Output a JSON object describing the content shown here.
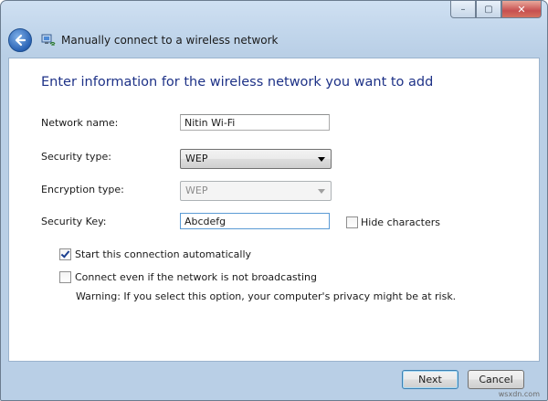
{
  "window": {
    "title": "Manually connect to a wireless network",
    "caption_buttons": {
      "minimize": "–",
      "maximize": "▢",
      "close": "✕"
    }
  },
  "icons": {
    "back": "back-arrow-icon",
    "network": "wireless-network-icon"
  },
  "form": {
    "heading": "Enter information for the wireless network you want to add",
    "network_name": {
      "label": "Network name:",
      "value": "Nitin Wi-Fi"
    },
    "security_type": {
      "label": "Security type:",
      "value": "WEP"
    },
    "encryption_type": {
      "label": "Encryption type:",
      "value": "WEP"
    },
    "security_key": {
      "label": "Security Key:",
      "value": "Abcdefg"
    },
    "hide_characters": {
      "label": "Hide characters",
      "checked": false
    },
    "start_automatically": {
      "label": "Start this connection automatically",
      "checked": true
    },
    "connect_even": {
      "label": "Connect even if the network is not broadcasting",
      "checked": false
    },
    "warning": "Warning: If you select this option, your computer's privacy might be at risk."
  },
  "buttons": {
    "next": "Next",
    "cancel": "Cancel"
  },
  "watermark": "wsxdn.com"
}
